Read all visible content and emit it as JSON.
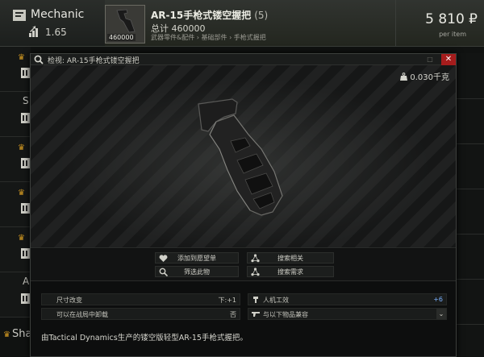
{
  "trader": {
    "name": "Mechanic",
    "level": "1.65"
  },
  "offer": {
    "title": "AR-15手枪式镂空握把",
    "quantity": "(5)",
    "total": "总计 460000",
    "category": "武器零件&配件 › 基础部件 › 手枪式握把",
    "thumb_count": "460000",
    "price": "5 810 ₽",
    "per_item": "per item"
  },
  "background_rows": {
    "letters": [
      "S",
      "A"
    ],
    "bottom_text": "Sha"
  },
  "window": {
    "title": "检视: AR-15手枪式镂空握把",
    "min_label": "□",
    "close_label": "✕",
    "weight": "0.030千克"
  },
  "actions": {
    "wishlist": "添加到愿望单",
    "search_related": "搜索相关",
    "filter_by": "筛选此物",
    "search_needs": "搜索需求"
  },
  "stats": {
    "size_label": "尺寸改变",
    "size_value": "下:+1",
    "ergo_label": "人机工效",
    "ergo_value": "+6",
    "fold_label": "可以在战局中卸载",
    "fold_value": "否",
    "compat_label": "与以下物品兼容",
    "compat_chevron": "⌄"
  },
  "description": "由Tactical Dynamics生产的镂空版轻型AR-15手枪式握把。",
  "colors": {
    "accent_gold": "#d49a22",
    "close_red": "#a51c1c",
    "ergo_blue": "#7ab0ff"
  }
}
